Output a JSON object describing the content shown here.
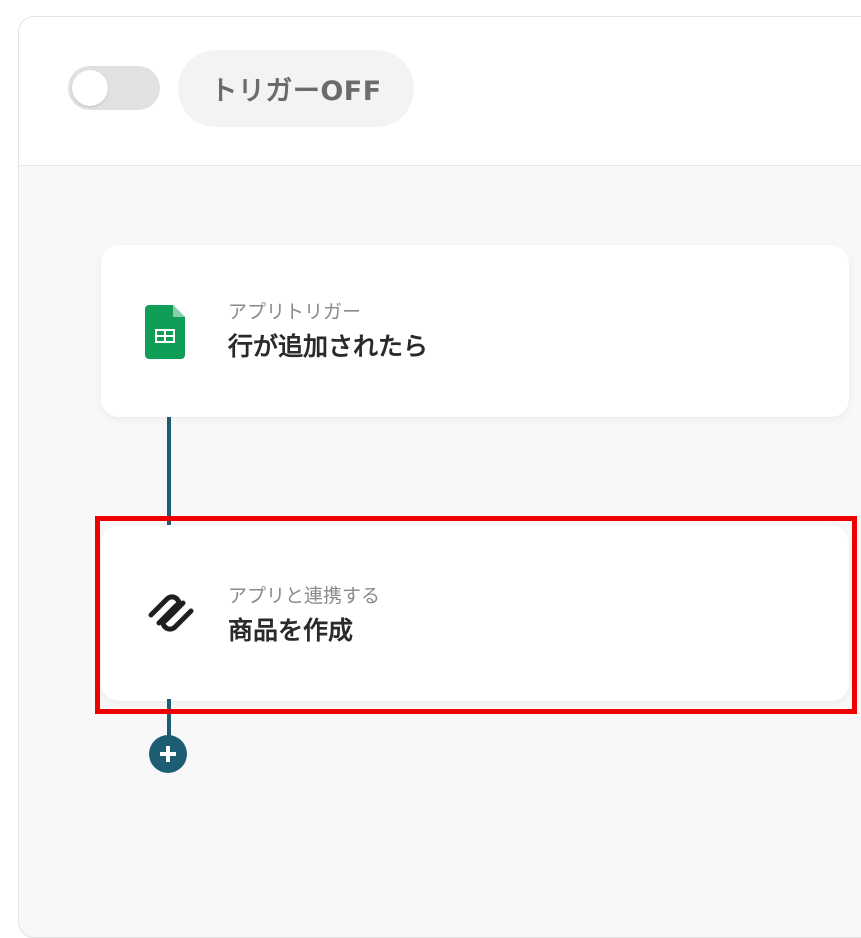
{
  "header": {
    "trigger_toggle": {
      "state": "off"
    },
    "trigger_status_label": "トリガーOFF"
  },
  "flow": {
    "steps": [
      {
        "icon": "google-sheets-icon",
        "subtitle": "アプリトリガー",
        "title": "行が追加されたら"
      },
      {
        "icon": "squarespace-icon",
        "subtitle": "アプリと連携する",
        "title": "商品を作成"
      }
    ],
    "add_step_icon": "plus-icon"
  },
  "colors": {
    "connector": "#1d5d73",
    "highlight": "#ee0000",
    "sheets_green": "#0f9d58"
  }
}
